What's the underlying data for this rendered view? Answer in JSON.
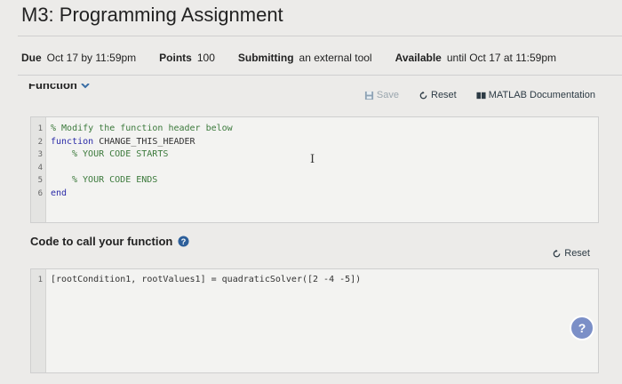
{
  "page": {
    "title": "M3: Programming Assignment"
  },
  "meta": {
    "due_label": "Due",
    "due_value": "Oct 17 by 11:59pm",
    "points_label": "Points",
    "points_value": "100",
    "submitting_label": "Submitting",
    "submitting_value": "an external tool",
    "available_label": "Available",
    "available_value": "until Oct 17 at 11:59pm"
  },
  "function_section": {
    "label": "Function",
    "toolbar": {
      "save": "Save",
      "reset": "Reset",
      "docs": "MATLAB Documentation"
    },
    "lines": [
      {
        "n": "1",
        "text": "% Modify the function header below"
      },
      {
        "n": "2",
        "kw": "function",
        "text": " CHANGE_THIS_HEADER"
      },
      {
        "n": "3",
        "text": "% YOUR CODE STARTS"
      },
      {
        "n": "4",
        "text": ""
      },
      {
        "n": "5",
        "text": "% YOUR CODE ENDS"
      },
      {
        "n": "6",
        "text": "end"
      }
    ]
  },
  "call_section": {
    "label": "Code to call your function",
    "reset": "Reset",
    "lines": [
      {
        "n": "1",
        "text": "[rootCondition1, rootValues1] = quadraticSolver([2 -4 -5])"
      }
    ]
  },
  "help_fab": "?",
  "colors": {
    "accent": "#2d3b45",
    "fab": "#7b8fc7",
    "comment": "#3c7a3c",
    "keyword": "#2a2aa8"
  }
}
